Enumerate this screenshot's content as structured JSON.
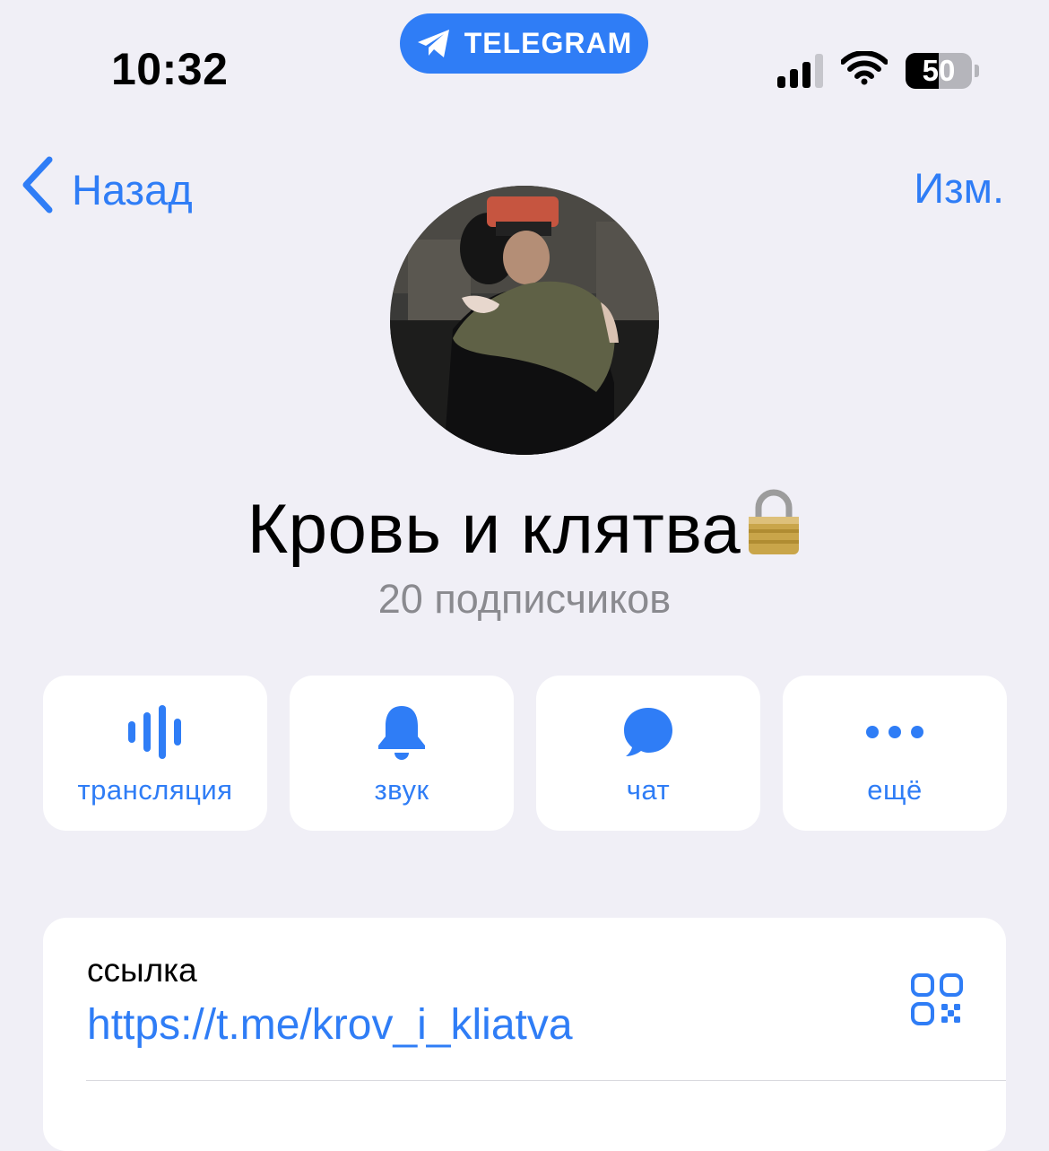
{
  "status_bar": {
    "time": "10:32",
    "pill_label": "TELEGRAM",
    "battery_level": "50",
    "battery_fraction": 0.5,
    "signal_bars_active": 3,
    "signal_bars_total": 4
  },
  "nav": {
    "back_label": "Назад",
    "edit_label": "Изм."
  },
  "channel": {
    "title": "Кровь и клятва",
    "subscribers": "20 подписчиков",
    "title_icon": "lock-icon"
  },
  "actions": [
    {
      "label": "трансляция",
      "icon": "live-stream-icon"
    },
    {
      "label": "звук",
      "icon": "bell-icon"
    },
    {
      "label": "чат",
      "icon": "chat-bubble-icon"
    },
    {
      "label": "ещё",
      "icon": "more-dots-icon"
    }
  ],
  "info": {
    "link_label": "ссылка",
    "link_value": "https://t.me/krov_i_kliatva",
    "qr_icon": "qr-code-icon"
  },
  "colors": {
    "accent": "#2f7df6",
    "background": "#f0eff6",
    "card": "#ffffff",
    "secondary_text": "#8a8a8f"
  }
}
